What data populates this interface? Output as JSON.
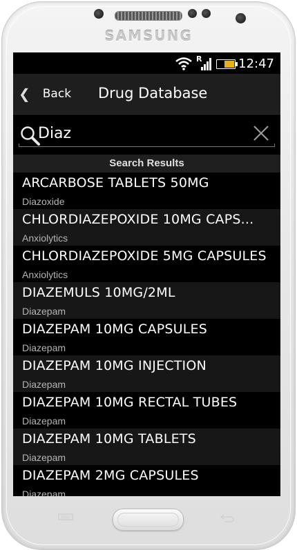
{
  "device": {
    "brand": "SAMSUNG"
  },
  "status_bar": {
    "time": "12:47",
    "network_label": "R",
    "battery_color": "#e5b21b"
  },
  "action_bar": {
    "back_label": "Back",
    "title": "Drug Database"
  },
  "search": {
    "value": "Diaz",
    "placeholder": ""
  },
  "results_header": "Search Results",
  "results": [
    {
      "name": "ARCARBOSE TABLETS 50MG",
      "category": "Diazoxide"
    },
    {
      "name": "CHLORDIAZEPOXIDE 10MG CAPS...",
      "category": "Anxiolytics"
    },
    {
      "name": "CHLORDIAZEPOXIDE 5MG CAPSULES",
      "category": "Anxiolytics"
    },
    {
      "name": "DIAZEMULS 10MG/2ML",
      "category": "Diazepam"
    },
    {
      "name": "DIAZEPAM 10MG CAPSULES",
      "category": "Diazepam"
    },
    {
      "name": "DIAZEPAM 10MG INJECTION",
      "category": "Diazepam"
    },
    {
      "name": "DIAZEPAM 10MG RECTAL TUBES",
      "category": "Diazepam"
    },
    {
      "name": "DIAZEPAM 10MG TABLETS",
      "category": "Diazepam"
    },
    {
      "name": "DIAZEPAM 2MG CAPSULES",
      "category": "Diazepam"
    }
  ],
  "icons": {
    "back": "chevron-left-icon",
    "search": "search-icon",
    "clear": "close-icon",
    "wifi": "wifi-icon",
    "signal": "signal-icon",
    "battery": "battery-icon",
    "menu": "menu-key-icon",
    "home": "home-button",
    "back_key": "back-key-icon"
  }
}
